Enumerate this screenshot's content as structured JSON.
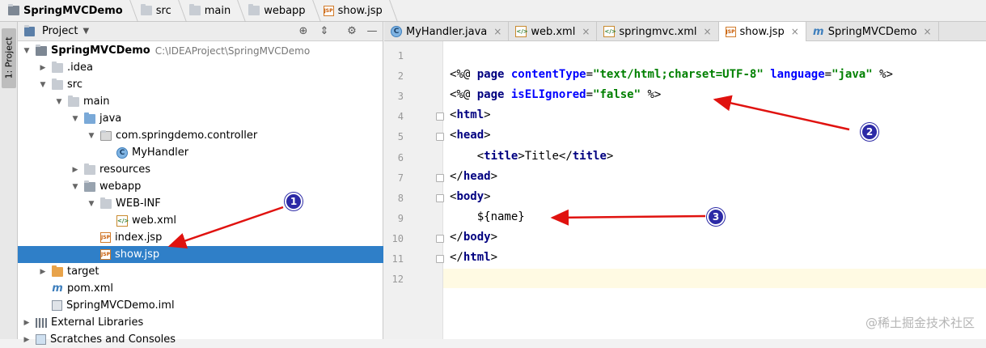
{
  "breadcrumb": [
    "SpringMVCDemo",
    "src",
    "main",
    "webapp",
    "show.jsp"
  ],
  "toolstrip": {
    "project_tab": "1: Project"
  },
  "project_panel": {
    "title": "Project",
    "tree": [
      {
        "label": "SpringMVCDemo",
        "path": "C:\\IDEAProject\\SpringMVCDemo",
        "icon": "module-folder-icon",
        "expanded": true,
        "depth": 0
      },
      {
        "label": ".idea",
        "icon": "folder-icon",
        "expanded": false,
        "depth": 1
      },
      {
        "label": "src",
        "icon": "folder-icon",
        "expanded": true,
        "depth": 1
      },
      {
        "label": "main",
        "icon": "folder-icon",
        "expanded": true,
        "depth": 2
      },
      {
        "label": "java",
        "icon": "source-folder-icon",
        "expanded": true,
        "depth": 3
      },
      {
        "label": "com.springdemo.controller",
        "icon": "package-icon",
        "expanded": true,
        "depth": 4
      },
      {
        "label": "MyHandler",
        "icon": "class-icon",
        "depth": 5
      },
      {
        "label": "resources",
        "icon": "folder-icon",
        "expanded": false,
        "depth": 3
      },
      {
        "label": "webapp",
        "icon": "web-folder-icon",
        "expanded": true,
        "depth": 3
      },
      {
        "label": "WEB-INF",
        "icon": "folder-icon",
        "expanded": true,
        "depth": 4
      },
      {
        "label": "web.xml",
        "icon": "web-xml-icon",
        "depth": 5
      },
      {
        "label": "index.jsp",
        "icon": "jsp-icon",
        "depth": 4
      },
      {
        "label": "show.jsp",
        "icon": "jsp-icon",
        "depth": 4,
        "selected": true
      },
      {
        "label": "target",
        "icon": "excluded-folder-icon",
        "expanded": false,
        "depth": 1
      },
      {
        "label": "pom.xml",
        "icon": "maven-icon",
        "depth": 1
      },
      {
        "label": "SpringMVCDemo.iml",
        "icon": "iml-icon",
        "depth": 1
      },
      {
        "label": "External Libraries",
        "icon": "library-icon",
        "expanded": false,
        "depth": 0
      },
      {
        "label": "Scratches and Consoles",
        "icon": "scratch-icon",
        "expanded": false,
        "depth": 0
      }
    ]
  },
  "tabs": [
    {
      "label": "MyHandler.java",
      "icon": "class-icon"
    },
    {
      "label": "web.xml",
      "icon": "web-xml-icon"
    },
    {
      "label": "springmvc.xml",
      "icon": "spring-xml-icon"
    },
    {
      "label": "show.jsp",
      "icon": "jsp-icon",
      "active": true
    },
    {
      "label": "SpringMVCDemo",
      "icon": "maven-icon"
    }
  ],
  "editor": {
    "line_numbers": [
      "1",
      "2",
      "3",
      "4",
      "5",
      "6",
      "7",
      "8",
      "9",
      "10",
      "11",
      "12"
    ],
    "current_line": "12",
    "lines": [
      [],
      [
        [
          "<%@ ",
          "t"
        ],
        [
          "page",
          "kw"
        ],
        [
          " ",
          "t"
        ],
        [
          "contentType",
          "attr"
        ],
        [
          "=",
          "t"
        ],
        [
          "\"text/html;charset=UTF-8\"",
          "str"
        ],
        [
          " ",
          "t"
        ],
        [
          "language",
          "attr"
        ],
        [
          "=",
          "t"
        ],
        [
          "\"java\"",
          "str"
        ],
        [
          " %>",
          "t"
        ]
      ],
      [
        [
          "<%@ ",
          "t"
        ],
        [
          "page",
          "kw"
        ],
        [
          " ",
          "t"
        ],
        [
          "isELIgnored",
          "attr"
        ],
        [
          "=",
          "t"
        ],
        [
          "\"false\"",
          "str"
        ],
        [
          " %>",
          "t"
        ]
      ],
      [
        [
          "<",
          "t"
        ],
        [
          "html",
          "kw"
        ],
        [
          ">",
          "t"
        ]
      ],
      [
        [
          "<",
          "t"
        ],
        [
          "head",
          "kw"
        ],
        [
          ">",
          "t"
        ]
      ],
      [
        [
          "    ",
          "t"
        ],
        [
          "<",
          "t"
        ],
        [
          "title",
          "kw"
        ],
        [
          ">Title</",
          "t"
        ],
        [
          "title",
          "kw"
        ],
        [
          ">",
          "t"
        ]
      ],
      [
        [
          "</",
          "t"
        ],
        [
          "head",
          "kw"
        ],
        [
          ">",
          "t"
        ]
      ],
      [
        [
          "<",
          "t"
        ],
        [
          "body",
          "kw"
        ],
        [
          ">",
          "t"
        ]
      ],
      [
        [
          "    ${name}",
          "t"
        ]
      ],
      [
        [
          "</",
          "t"
        ],
        [
          "body",
          "kw"
        ],
        [
          ">",
          "t"
        ]
      ],
      [
        [
          "</",
          "t"
        ],
        [
          "html",
          "kw"
        ],
        [
          ">",
          "t"
        ]
      ],
      []
    ]
  },
  "annotations": [
    "1",
    "2",
    "3"
  ],
  "watermark": "@稀土掘金技术社区",
  "colors": {
    "selection": "#2f7fc8",
    "tag": "#000080",
    "attribute": "#0000ff",
    "string": "#008000",
    "arrow": "#e0120f",
    "badge": "#2c2aa6"
  }
}
